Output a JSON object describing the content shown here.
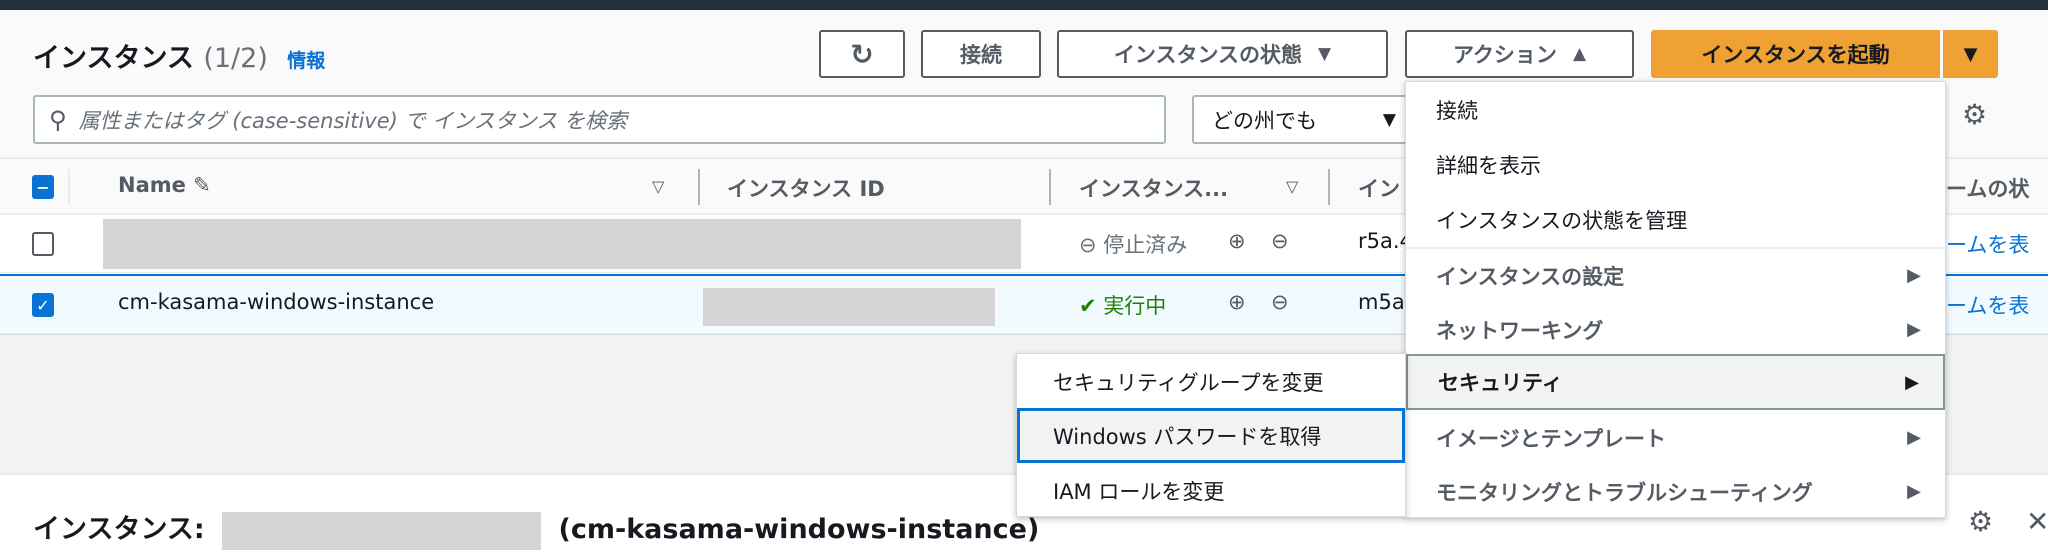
{
  "header": {
    "title": "インスタンス",
    "count": "(1/2)",
    "info": "情報"
  },
  "toolbar": {
    "refresh_icon": "refresh-icon",
    "connect": "接続",
    "instance_state": "インスタンスの状態",
    "actions": "アクション",
    "launch": "インスタンスを起動"
  },
  "search": {
    "placeholder": "属性またはタグ (case-sensitive) で インスタンス を検索"
  },
  "region_filter": {
    "value": "どの州でも"
  },
  "table": {
    "columns": [
      "Name",
      "インスタンス ID",
      "インスタンス...",
      "イン",
      "ームの状"
    ],
    "rows": [
      {
        "name": "",
        "status": "停止済み",
        "type": "r5a.4",
        "alarm": "ームを表",
        "selected": false
      },
      {
        "name": "cm-kasama-windows-instance",
        "status": "実行中",
        "type": "m5a",
        "alarm": "ームを表",
        "selected": true
      }
    ]
  },
  "actions_menu": {
    "items": [
      "接続",
      "詳細を表示",
      "インスタンスの状態を管理",
      "インスタンスの設定",
      "ネットワーキング",
      "セキュリティ",
      "イメージとテンプレート",
      "モニタリングとトラブルシューティング"
    ]
  },
  "security_submenu": {
    "items": [
      "セキュリティグループを変更",
      "Windows パスワードを取得",
      "IAM ロールを変更"
    ]
  },
  "details": {
    "title": "インスタンス:",
    "name": "(cm-kasama-windows-instance)"
  },
  "colors": {
    "accent": "#0972d3",
    "primary": "#f0a133",
    "running": "#1d8102",
    "stopped": "#687078"
  }
}
